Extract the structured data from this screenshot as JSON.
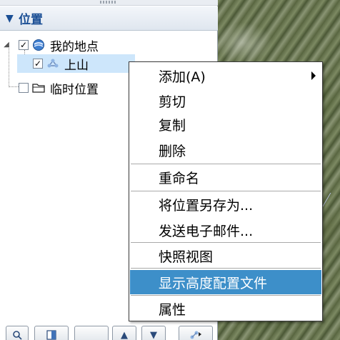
{
  "places_panel": {
    "title": "位置",
    "tree": [
      {
        "label": "我的地点",
        "checked": true,
        "expanded": true,
        "icon": "globe-folder-icon"
      },
      {
        "label": "上山",
        "checked": true,
        "selected": true,
        "icon": "path-network-icon"
      },
      {
        "label": "临时位置",
        "checked": false,
        "icon": "folder-icon"
      }
    ]
  },
  "context_menu": {
    "items": [
      {
        "label": "添加(A)",
        "has_submenu": true
      },
      {
        "label": "剪切"
      },
      {
        "label": "复制"
      },
      {
        "label": "删除"
      },
      {
        "label": "重命名"
      },
      {
        "label": "将位置另存为..."
      },
      {
        "label": "发送电子邮件..."
      },
      {
        "label": "快照视图"
      },
      {
        "label": "显示高度配置文件",
        "highlighted": true
      },
      {
        "label": "属性"
      }
    ],
    "highlight_color": "#3d8fc9"
  },
  "toolbar": {
    "icons": [
      "search-icon",
      "layers-panel-icon",
      "move-up-icon",
      "move-down-icon",
      "tour-icon"
    ]
  },
  "colors": {
    "header_text": "#1b4f95",
    "selection_bg": "#cde6fb"
  }
}
